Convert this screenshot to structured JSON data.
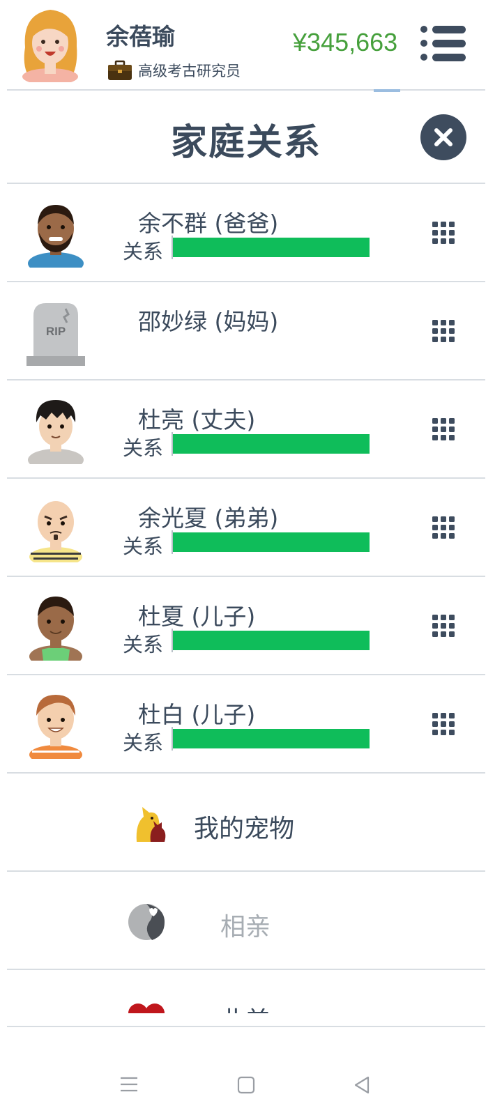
{
  "player": {
    "name": "余蓓瑜",
    "job": "高级考古研究员",
    "money": "¥345,663",
    "avatar_icon": "female-avatar-icon",
    "job_icon": "briefcase-icon"
  },
  "header": {
    "menu_icon": "menu-list-icon"
  },
  "panel": {
    "title": "家庭关系",
    "close_icon": "close-icon"
  },
  "relationship_label": "关系",
  "relationship_color": "#0fbd5a",
  "family": [
    {
      "name": "余不群 (爸爸)",
      "relationship": 1.0,
      "deceased": false,
      "avatar": "father-avatar-icon"
    },
    {
      "name": "邵妙绿 (妈妈)",
      "relationship": null,
      "deceased": true,
      "avatar": "rip-tombstone-icon"
    },
    {
      "name": "杜亮 (丈夫)",
      "relationship": 1.0,
      "deceased": false,
      "avatar": "husband-avatar-icon"
    },
    {
      "name": "余光夏 (弟弟)",
      "relationship": 1.0,
      "deceased": false,
      "avatar": "brother-avatar-icon"
    },
    {
      "name": "杜夏 (儿子)",
      "relationship": 1.0,
      "deceased": false,
      "avatar": "son-avatar-icon"
    },
    {
      "name": "杜白 (儿子)",
      "relationship": 1.0,
      "deceased": false,
      "avatar": "son-avatar-icon"
    }
  ],
  "options": {
    "pets": {
      "label": "我的宠物",
      "icon": "pets-icon"
    },
    "dating": {
      "label": "相亲",
      "icon": "dating-icon"
    },
    "partial": {
      "label": "此美",
      "icon": "hearts-icon"
    }
  },
  "system_nav": {
    "menu_icon": "recent-apps-icon",
    "home_icon": "home-icon",
    "back_icon": "back-icon"
  }
}
